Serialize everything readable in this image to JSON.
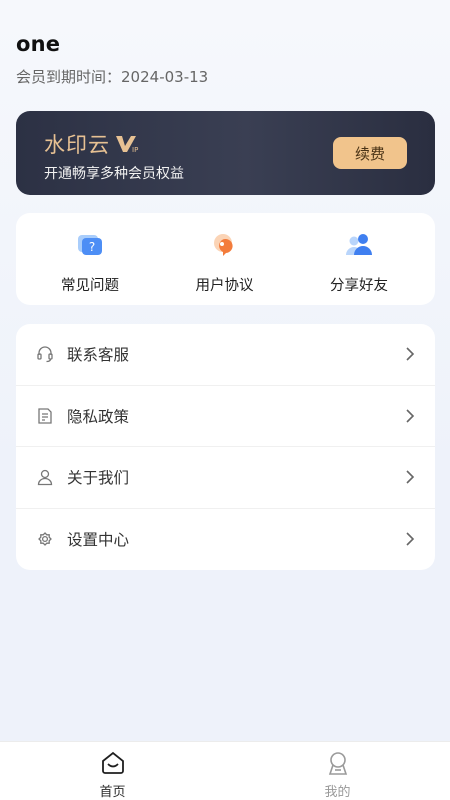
{
  "profile": {
    "username": "one",
    "expiry_label": "会员到期时间：",
    "expiry_date": "2024-03-13"
  },
  "vip_card": {
    "brand": "水印云",
    "badge": "VIP",
    "subtitle": "开通畅享多种会员权益",
    "renew_label": "续费"
  },
  "quick_actions": [
    {
      "label": "常见问题",
      "icon": "faq-icon"
    },
    {
      "label": "用户协议",
      "icon": "user-agreement-icon"
    },
    {
      "label": "分享好友",
      "icon": "share-friends-icon"
    }
  ],
  "menu": [
    {
      "label": "联系客服",
      "icon": "headset-icon"
    },
    {
      "label": "隐私政策",
      "icon": "document-icon"
    },
    {
      "label": "关于我们",
      "icon": "person-icon"
    },
    {
      "label": "设置中心",
      "icon": "gear-icon"
    }
  ],
  "tabbar": {
    "home_label": "首页",
    "mine_label": "我的",
    "active": "home"
  },
  "colors": {
    "accent_gold": "#e7c193",
    "renew_button": "#f1c48c",
    "card_dark": "#2c3144"
  }
}
